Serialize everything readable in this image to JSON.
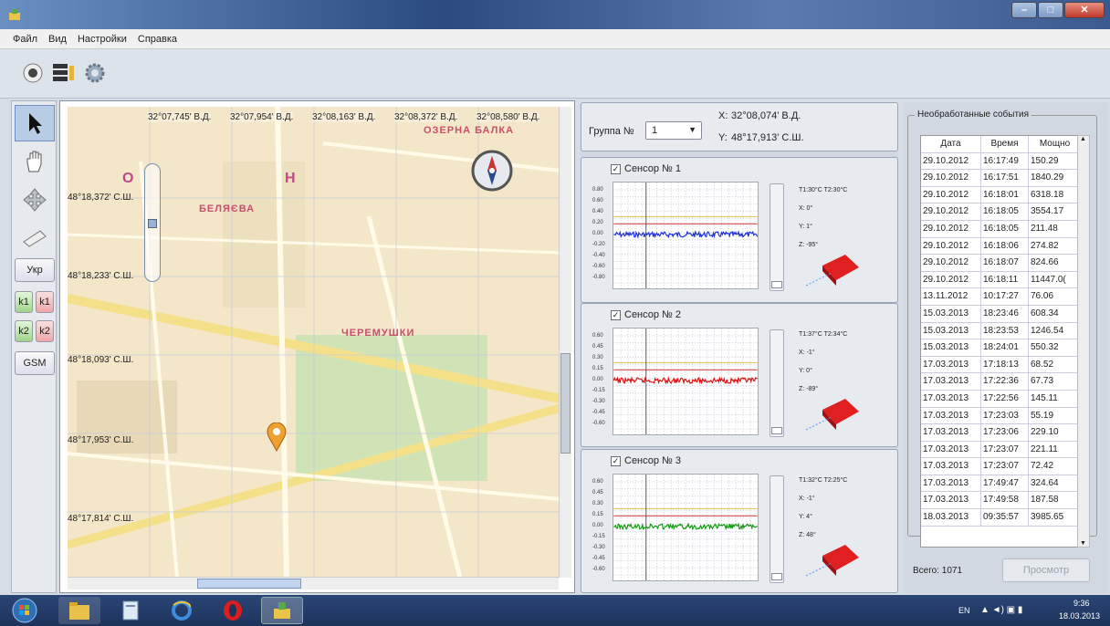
{
  "menu": [
    "Файл",
    "Вид",
    "Настройки",
    "Справка"
  ],
  "toolbar": {
    "icons": [
      "record-icon",
      "server-icon",
      "gear-icon"
    ]
  },
  "tools": {
    "icons": [
      "pointer-icon",
      "hand-icon",
      "move-arrows-icon",
      "ruler-icon"
    ],
    "buttons": {
      "ukr": "Укр",
      "k1": "k1",
      "k2": "k2",
      "gsm": "GSM"
    }
  },
  "map": {
    "lon_labels": [
      "32°07,745' В.Д.",
      "32°07,954' В.Д.",
      "32°08,163' В.Д.",
      "32°08,372' В.Д.",
      "32°08,580' В.Д."
    ],
    "lat_labels": [
      "48°18,372' С.Ш.",
      "48°18,233' С.Ш.",
      "48°18,093' С.Ш.",
      "48°17,953' С.Ш.",
      "48°17,814' С.Ш."
    ],
    "places": [
      "ОЗЕРНА БАЛКА",
      "БЕЛЯЄВА",
      "ЧЕРЕМУШКИ"
    ],
    "letters": [
      "О",
      "Н"
    ]
  },
  "group": {
    "label": "Группа №",
    "value": "1",
    "x_label": "X:",
    "x_value": "32°08,074' В.Д.",
    "y_label": "Y:",
    "y_value": "48°17,913' С.Ш."
  },
  "sensors": [
    {
      "name": "Сенсор № 1",
      "color": "#1a2fd6",
      "t": "T1:30°C  T2:30°C",
      "x": "X:  0°",
      "y": "Y:  1°",
      "z": "Z:  -95°",
      "yticks": [
        "0.80",
        "0.60",
        "0.40",
        "0.20",
        "0.00",
        "-0.20",
        "-0.40",
        "-0.60",
        "-0.80"
      ]
    },
    {
      "name": "Сенсор № 2",
      "color": "#e01010",
      "t": "T1:37°C  T2:34°C",
      "x": "X:  -1°",
      "y": "Y:  0°",
      "z": "Z:  -89°",
      "yticks": [
        "0.60",
        "0.45",
        "0.30",
        "0.15",
        "0.00",
        "-0.15",
        "-0.30",
        "-0.45",
        "-0.60"
      ]
    },
    {
      "name": "Сенсор № 3",
      "color": "#139a13",
      "t": "T1:32°C  T2:25°C",
      "x": "X:  -1°",
      "y": "Y:  4°",
      "z": "Z:  48°",
      "yticks": [
        "0.60",
        "0.45",
        "0.30",
        "0.15",
        "0.00",
        "-0.15",
        "-0.30",
        "-0.45",
        "-0.60"
      ]
    }
  ],
  "events": {
    "title": "Необработанные события",
    "columns": [
      "Дата",
      "Время",
      "Мощно"
    ],
    "rows": [
      [
        "29.10.2012",
        "16:17:49",
        "150.29"
      ],
      [
        "29.10.2012",
        "16:17:51",
        "1840.29"
      ],
      [
        "29.10.2012",
        "16:18:01",
        "6318.18"
      ],
      [
        "29.10.2012",
        "16:18:05",
        "3554.17"
      ],
      [
        "29.10.2012",
        "16:18:05",
        "211.48"
      ],
      [
        "29.10.2012",
        "16:18:06",
        "274.82"
      ],
      [
        "29.10.2012",
        "16:18:07",
        "824.66"
      ],
      [
        "29.10.2012",
        "16:18:11",
        "11447.0("
      ],
      [
        "13.11.2012",
        "10:17:27",
        "76.06"
      ],
      [
        "15.03.2013",
        "18:23:46",
        "608.34"
      ],
      [
        "15.03.2013",
        "18:23:53",
        "1246.54"
      ],
      [
        "15.03.2013",
        "18:24:01",
        "550.32"
      ],
      [
        "17.03.2013",
        "17:18:13",
        "68.52"
      ],
      [
        "17.03.2013",
        "17:22:36",
        "67.73"
      ],
      [
        "17.03.2013",
        "17:22:56",
        "145.11"
      ],
      [
        "17.03.2013",
        "17:23:03",
        "55.19"
      ],
      [
        "17.03.2013",
        "17:23:06",
        "229.10"
      ],
      [
        "17.03.2013",
        "17:23:07",
        "221.11"
      ],
      [
        "17.03.2013",
        "17:23:07",
        "72.42"
      ],
      [
        "17.03.2013",
        "17:49:47",
        "324.64"
      ],
      [
        "17.03.2013",
        "17:49:58",
        "187.58"
      ],
      [
        "18.03.2013",
        "09:35:57",
        "3985.65"
      ]
    ],
    "total": "Всего: 1071",
    "view_button": "Просмотр"
  },
  "taskbar": {
    "lang": "EN",
    "time": "9:36",
    "date": "18.03.2013"
  }
}
